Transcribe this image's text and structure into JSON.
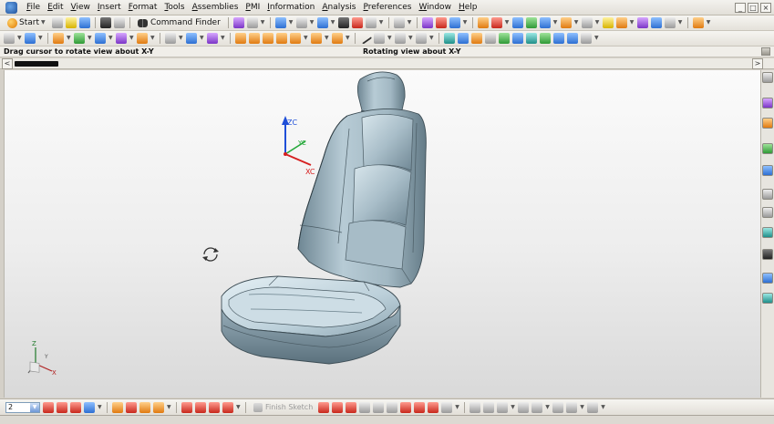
{
  "menubar": {
    "items": [
      "File",
      "Edit",
      "View",
      "Insert",
      "Format",
      "Tools",
      "Assemblies",
      "PMI",
      "Information",
      "Analysis",
      "Preferences",
      "Window",
      "Help"
    ]
  },
  "window_controls": {
    "minimize": "_",
    "restore": "□",
    "close": "×"
  },
  "toolbar1": {
    "start_label": "Start",
    "command_finder_label": "Command Finder"
  },
  "statusline": {
    "left": "Drag cursor to rotate view about X-Y",
    "center": "Rotating view about X-Y"
  },
  "navrow": {
    "left_arrow": "<",
    "right_arrow": ">"
  },
  "viewport": {
    "triad_labels": {
      "z": "ZC",
      "y": "YC",
      "x": "XC"
    },
    "mini_triad_labels": {
      "z": "Z",
      "y": "Y",
      "x": "X"
    }
  },
  "bottombar": {
    "selection_value": "2",
    "finish_sketch_label": "Finish Sketch"
  },
  "colors": {
    "seat_fill": "#9fb6c2",
    "seat_highlight": "#d4e3ea",
    "seat_shadow": "#5f7682",
    "axis_z": "#1f4fd8",
    "axis_y": "#22a838",
    "axis_x": "#d62020"
  }
}
